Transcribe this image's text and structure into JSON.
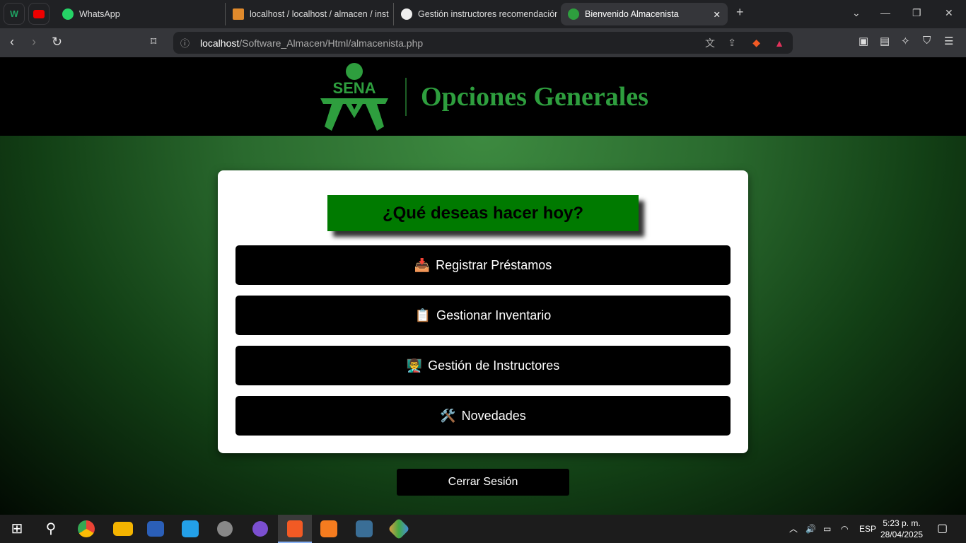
{
  "browser": {
    "tabs": [
      {
        "label": "WhatsApp",
        "icon": "whatsapp-icon"
      },
      {
        "label": "localhost / localhost / almacen / inst",
        "icon": "phpmyadmin-icon"
      },
      {
        "label": "Gestión instructores recomendación",
        "icon": "chatgpt-icon"
      },
      {
        "label": "Bienvenido Almacenista",
        "icon": "sena-icon",
        "active": true
      }
    ],
    "new_tab": "+",
    "url_host": "localhost",
    "url_path": "/Software_Almacen/Html/almacenista.php"
  },
  "header": {
    "logo_text": "SENA",
    "title": "Opciones Generales"
  },
  "card": {
    "question": "¿Qué deseas hacer hoy?",
    "options": [
      {
        "icon": "📥",
        "label": "Registrar Préstamos"
      },
      {
        "icon": "📋",
        "label": "Gestionar Inventario"
      },
      {
        "icon": "👨‍🏫",
        "label": "Gestión de Instructores"
      },
      {
        "icon": "🛠️",
        "label": "Novedades"
      }
    ]
  },
  "logout": "Cerrar Sesión",
  "taskbar": {
    "lang": "ESP",
    "time": "5:23 p. m.",
    "date": "28/04/2025"
  }
}
